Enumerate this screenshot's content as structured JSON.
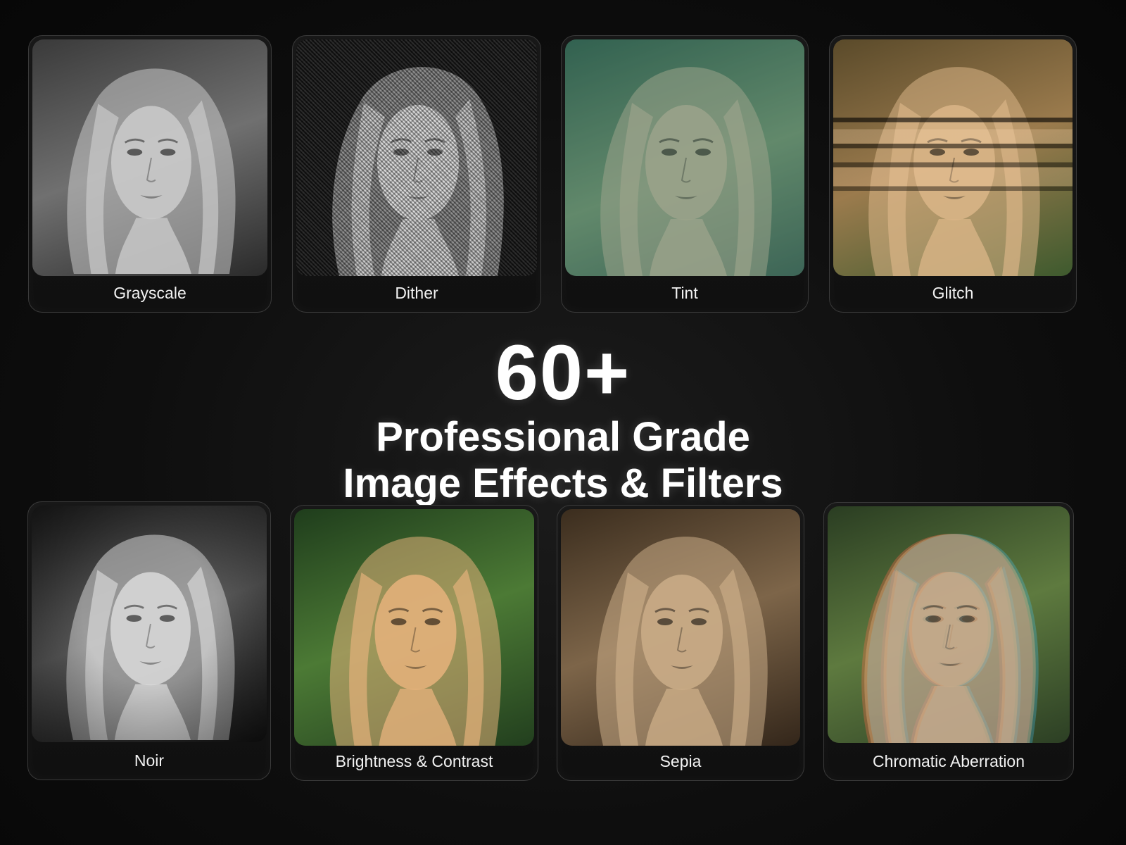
{
  "headline": {
    "count": "60+",
    "line1": "Professional Grade",
    "line2": "Image Effects & Filters"
  },
  "effects": [
    {
      "label": "Grayscale",
      "style": "grayscale"
    },
    {
      "label": "Dither",
      "style": "dither"
    },
    {
      "label": "Tint",
      "style": "tint"
    },
    {
      "label": "Glitch",
      "style": "glitch"
    },
    {
      "label": "Noir",
      "style": "noir"
    },
    {
      "label": "Brightness & Contrast",
      "style": "brightness"
    },
    {
      "label": "Sepia",
      "style": "sepia"
    },
    {
      "label": "Chromatic Aberration",
      "style": "chromatic"
    }
  ]
}
